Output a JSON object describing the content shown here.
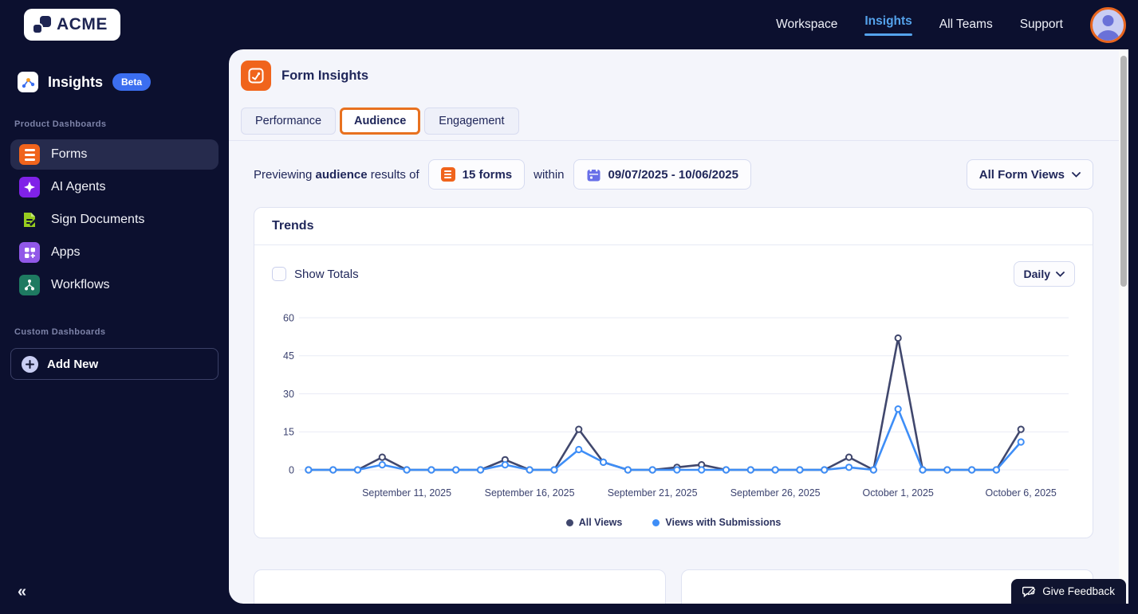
{
  "topbar": {
    "brand": "ACME",
    "nav": [
      {
        "label": "Workspace",
        "active": false
      },
      {
        "label": "Insights",
        "active": true
      },
      {
        "label": "All Teams",
        "active": false
      },
      {
        "label": "Support",
        "active": false
      }
    ]
  },
  "sidebar": {
    "app_title": "Insights",
    "beta_badge": "Beta",
    "product_section_label": "Product Dashboards",
    "items": [
      {
        "label": "Forms",
        "active": true,
        "icon": "forms-icon"
      },
      {
        "label": "AI Agents",
        "active": false,
        "icon": "ai-agents-icon"
      },
      {
        "label": "Sign Documents",
        "active": false,
        "icon": "sign-documents-icon"
      },
      {
        "label": "Apps",
        "active": false,
        "icon": "apps-icon"
      },
      {
        "label": "Workflows",
        "active": false,
        "icon": "workflows-icon"
      }
    ],
    "custom_section_label": "Custom Dashboards",
    "add_new_label": "Add New",
    "collapse_glyph": "«"
  },
  "main": {
    "header_title": "Form Insights",
    "tabs": [
      {
        "label": "Performance",
        "active": false
      },
      {
        "label": "Audience",
        "active": true
      },
      {
        "label": "Engagement",
        "active": false
      }
    ],
    "filter_bar": {
      "preview_prefix": "Previewing",
      "preview_bold": "audience",
      "preview_suffix": "results of",
      "forms_button_label": "15 forms",
      "within_label": "within",
      "date_range_label": "09/07/2025 - 10/06/2025",
      "form_views_dropdown_label": "All Form Views"
    },
    "trends_card": {
      "title": "Trends",
      "show_totals_label": "Show Totals",
      "show_totals_checked": false,
      "granularity_label": "Daily"
    },
    "feedback_button_label": "Give Feedback"
  },
  "chart_data": {
    "type": "line",
    "title": "Trends",
    "num_points": 30,
    "date_range": "09/07/2025 - 10/06/2025",
    "x_tick_labels": [
      "September 11, 2025",
      "September 16, 2025",
      "September 21, 2025",
      "September 26, 2025",
      "October 1, 2025",
      "October 6, 2025"
    ],
    "x_tick_indices": [
      4,
      9,
      14,
      19,
      24,
      29
    ],
    "y_ticks": [
      0,
      15,
      30,
      45,
      60
    ],
    "ylim": [
      0,
      60
    ],
    "grid": true,
    "legend_position": "bottom",
    "series": [
      {
        "name": "All Views",
        "color": "#40476d",
        "values": [
          0,
          0,
          0,
          5,
          0,
          0,
          0,
          0,
          4,
          0,
          0,
          16,
          3,
          0,
          0,
          1,
          2,
          0,
          0,
          0,
          0,
          0,
          5,
          0,
          52,
          0,
          0,
          0,
          0,
          16
        ]
      },
      {
        "name": "Views with Submissions",
        "color": "#3e8ef7",
        "values": [
          0,
          0,
          0,
          2,
          0,
          0,
          0,
          0,
          2,
          0,
          0,
          8,
          3,
          0,
          0,
          0,
          0,
          0,
          0,
          0,
          0,
          0,
          1,
          0,
          24,
          0,
          0,
          0,
          0,
          11
        ]
      }
    ]
  },
  "colors": {
    "background_navy": "#0c102f",
    "accent_orange": "#e8711f",
    "active_nav_blue": "#55a3ec",
    "badge_blue": "#3b6ef0",
    "series_all_views": "#40476d",
    "series_views_with_submissions": "#3e8ef7"
  }
}
